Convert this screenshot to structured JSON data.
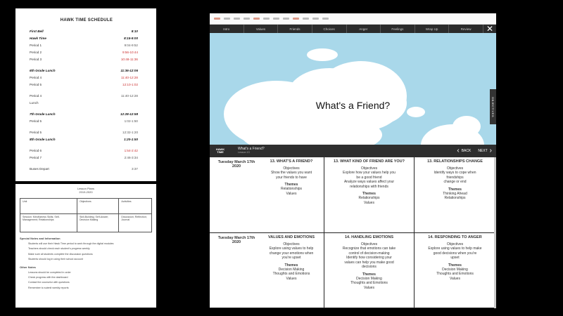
{
  "schedule": {
    "title": "HAWK TIME SCHEDULE",
    "rows": [
      {
        "name": "First Bell",
        "time": "8:10",
        "bold": true
      },
      {
        "name": "Hawk Time",
        "time": "8:15-9:00",
        "bold": true
      },
      {
        "name": "Period 1",
        "time": "9:04-9:52"
      },
      {
        "name": "Period 2",
        "time": "9:56-10:44",
        "red": true
      },
      {
        "name": "Period 3",
        "time": "10:48-11:36",
        "red": true
      },
      {
        "name": "6th Grade Lunch",
        "time": "11:36-12:06",
        "bold": true,
        "gap": true
      },
      {
        "name": "Period 4",
        "time": "11:40-12:28",
        "red": true
      },
      {
        "name": "Period 5",
        "time": "12:10-1:02",
        "red": true
      },
      {
        "name": "Period 4",
        "time": "11:40-12:28",
        "gap": true
      },
      {
        "name": "Lunch",
        "time": ""
      },
      {
        "name": "7th Grade Lunch",
        "time": "12:28-12:58",
        "bold": true,
        "gap": true
      },
      {
        "name": "Period 5",
        "time": "1:02-1:50"
      },
      {
        "name": "Period 5",
        "time": "12:32-1:20",
        "gap": true
      },
      {
        "name": "8th Grade Lunch",
        "time": "1:20-1:50",
        "bold": true
      },
      {
        "name": "Period 6",
        "time": "1:54-2:42",
        "gap": true,
        "red": true
      },
      {
        "name": "Period 7",
        "time": "2:46-3:34"
      },
      {
        "name": "Buses Depart",
        "time": "3:37",
        "gap": true
      }
    ]
  },
  "lesson_doc": {
    "header_line1": "Lesson Plans",
    "header_line2": "2019-2020",
    "columns": [
      "Unit",
      "Objectives",
      "Activities"
    ],
    "cells": [
      "Session: Mindfulness Skills; Self-Management; Relationships",
      "Skill-Building; Self-Aware; Decision Making",
      "Discussion; Reflection; Journal"
    ],
    "notes_heading": "Special Notes and Information",
    "bullets": [
      "Students will use their Hawk Time period to work through the digital modules",
      "Teachers should check each student's progress weekly",
      "Make sure all students complete the discussion questions",
      "Students should log in using their school account"
    ],
    "notes_heading2": "Other Notes",
    "bullets2": [
      "Lessons should be completed in order",
      "Check progress with the dashboard",
      "Contact the counselor with questions",
      "Remember to submit weekly reports"
    ]
  },
  "player": {
    "nav": [
      "Intro",
      "Values",
      "Friends",
      "Choices",
      "Anger",
      "Feelings",
      "Wrap Up",
      "Review"
    ],
    "slide_title": "What's a Friend?",
    "objectives_tab": "OBJECTIVES",
    "brand": "HAWK TIME",
    "track_title": "What's a Friend?",
    "track_sub": "Lesson 13",
    "back_label": "BACK",
    "next_label": "NEXT"
  },
  "lessons": {
    "rows": [
      {
        "day": "Tuesday March 17th 2020",
        "cells": [
          {
            "title": "13. WHAT'S A FRIEND?",
            "obj_label": "Objectives",
            "obj": [
              "Show the values you want",
              "your friends to have"
            ],
            "themes_label": "Themes",
            "themes": [
              "Relationships",
              "Values"
            ]
          },
          {
            "title": "13. WHAT KIND OF FRIEND ARE YOU?",
            "obj_label": "Objectives",
            "obj": [
              "Explore how your values help you",
              "be a good friend",
              "Analyze ways values affect your",
              "relationships with friends"
            ],
            "themes_label": "Themes",
            "themes": [
              "Relationships",
              "Values"
            ]
          },
          {
            "title": "13. RELATIONSHIPS CHANGE",
            "obj_label": "Objectives",
            "obj": [
              "Identify ways to cope when",
              "friendships",
              "change or end"
            ],
            "themes_label": "Themes",
            "themes": [
              "Thinking Ahead",
              "Relationships"
            ]
          }
        ]
      },
      {
        "day": "Tuesday March 17th 2020",
        "cells": [
          {
            "title": "VALUES AND EMOTIONS",
            "obj_label": "Objectives",
            "obj": [
              "Explore using values to help",
              "change your emotions when",
              "you're upset"
            ],
            "themes_label": "Themes",
            "themes": [
              "Decision Making",
              "Thoughts and Emotions",
              "Values"
            ]
          },
          {
            "title": "14. HANDLING EMOTIONS",
            "obj_label": "Objectives",
            "obj": [
              "Recognize that emotions can take",
              "control of decision-making",
              "Identify how considering your",
              "values can help you make good",
              "decisions"
            ],
            "themes_label": "Themes",
            "themes": [
              "Decision Making",
              "Thoughts and Emotions",
              "Values"
            ]
          },
          {
            "title": "14. RESPONDING TO ANGER",
            "obj_label": "Objectives",
            "obj": [
              "Explore using values to help make",
              "good decisions when you're",
              "upset"
            ],
            "themes_label": "Themes",
            "themes": [
              "Decision Making",
              "Thoughts and Emotions",
              "Values"
            ]
          }
        ]
      }
    ]
  }
}
